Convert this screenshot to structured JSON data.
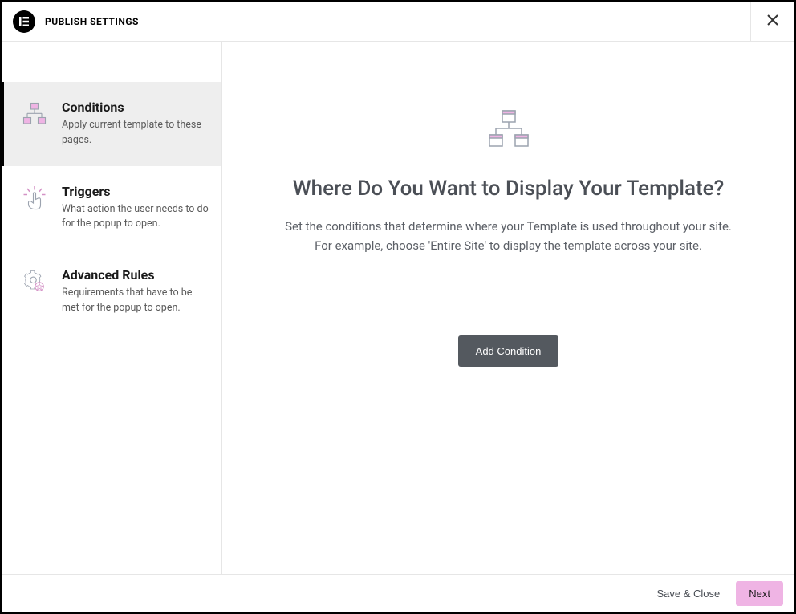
{
  "header": {
    "logo_text": "E",
    "title": "PUBLISH SETTINGS"
  },
  "sidebar": {
    "items": [
      {
        "title": "Conditions",
        "desc": "Apply current template to these pages.",
        "active": true
      },
      {
        "title": "Triggers",
        "desc": "What action the user needs to do for the popup to open.",
        "active": false
      },
      {
        "title": "Advanced Rules",
        "desc": "Requirements that have to be met for the popup to open.",
        "active": false
      }
    ]
  },
  "main": {
    "heading": "Where Do You Want to Display Your Template?",
    "body_line1": "Set the conditions that determine where your Template is used throughout your site.",
    "body_line2": "For example, choose 'Entire Site' to display the template across your site.",
    "add_condition_label": "Add Condition"
  },
  "footer": {
    "save_close_label": "Save & Close",
    "next_label": "Next"
  }
}
